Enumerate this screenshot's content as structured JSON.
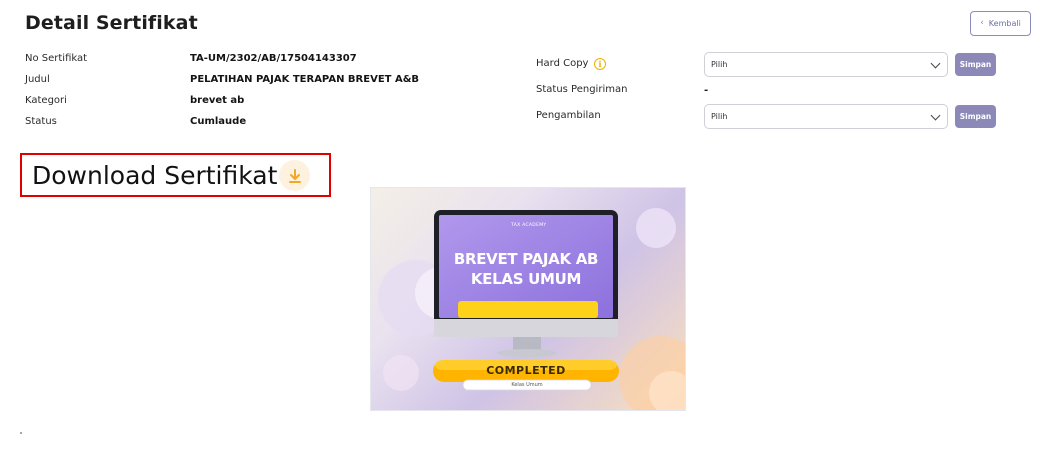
{
  "page": {
    "title": "Detail Sertifikat",
    "back_label": "Kembali"
  },
  "details": [
    {
      "label": "No Sertifikat",
      "value": "TA-UM/2302/AB/17504143307"
    },
    {
      "label": "Judul",
      "value": "PELATIHAN PAJAK TERAPAN BREVET A&B"
    },
    {
      "label": "Kategori",
      "value": "brevet ab"
    },
    {
      "label": "Status",
      "value": "Cumlaude"
    }
  ],
  "hard_copy": {
    "label": "Hard Copy",
    "info_icon": "info-icon",
    "select_value": "Pilih",
    "save_label": "Simpan"
  },
  "shipping": {
    "label": "Status Pengiriman",
    "value": "-"
  },
  "pickup": {
    "label": "Pengambilan",
    "select_value": "Pilih",
    "save_label": "Simpan"
  },
  "download": {
    "title": "Download Sertifikat",
    "icon": "download-icon"
  },
  "certificate": {
    "brand": "TAX ACADEMY",
    "headline_1": "BREVET PAJAK AB",
    "headline_2": "KELAS UMUM",
    "completed": "COMPLETED",
    "completed_sub": "Kelas Umum"
  },
  "colors": {
    "accent": "#8c89b8",
    "highlight_border": "#e00000",
    "info_icon": "#e8b400",
    "download_icon": "#f5a623"
  }
}
